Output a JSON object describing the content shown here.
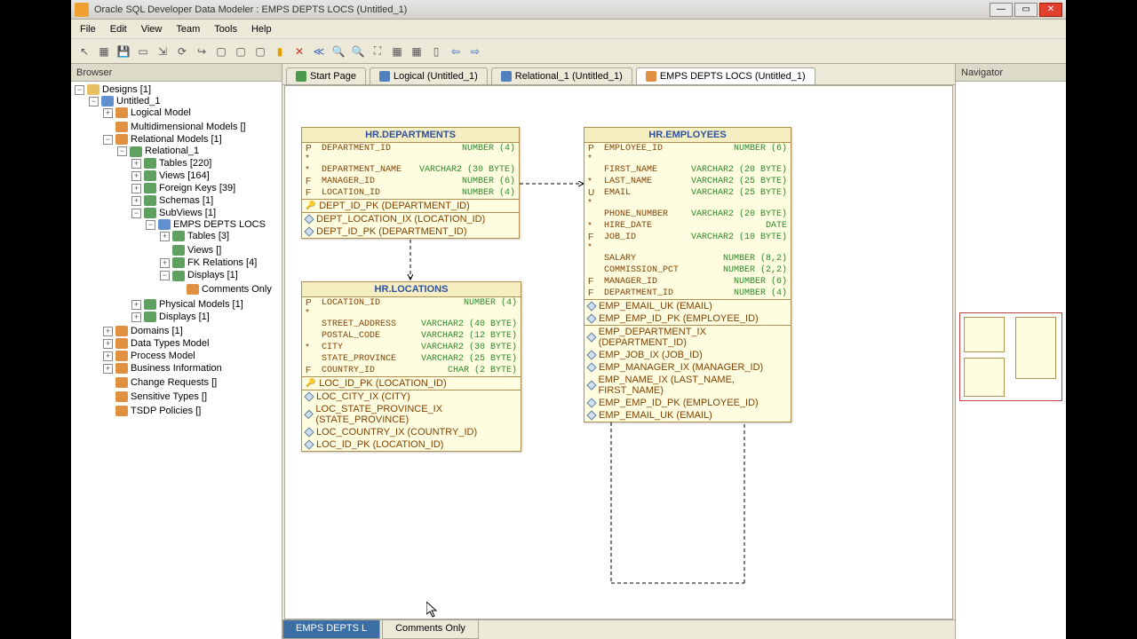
{
  "titlebar": {
    "app": "Oracle SQL Developer Data Modeler",
    "doc": "EMPS DEPTS LOCS (Untitled_1)"
  },
  "menu": [
    "File",
    "Edit",
    "View",
    "Team",
    "Tools",
    "Help"
  ],
  "panels": {
    "browser": "Browser",
    "navigator": "Navigator"
  },
  "tree": {
    "root": "Designs [1]",
    "untitled": "Untitled_1",
    "logical": "Logical Model",
    "multidim": "Multidimensional Models []",
    "relmodels": "Relational Models [1]",
    "rel1": "Relational_1",
    "tables": "Tables [220]",
    "views": "Views [164]",
    "fkeys": "Foreign Keys [39]",
    "schemas": "Schemas [1]",
    "subviews": "SubViews [1]",
    "emps": "EMPS DEPTS LOCS",
    "subtables": "Tables [3]",
    "subviews2": "Views []",
    "fkrel": "FK Relations [4]",
    "displays": "Displays [1]",
    "comments": "Comments Only",
    "physical": "Physical Models [1]",
    "displays2": "Displays [1]",
    "domains": "Domains [1]",
    "datatypes": "Data Types Model",
    "process": "Process Model",
    "business": "Business Information",
    "change": "Change Requests []",
    "sensitive": "Sensitive Types []",
    "tsdp": "TSDP Policies []"
  },
  "tabs": {
    "start": "Start Page",
    "logical": "Logical (Untitled_1)",
    "rel": "Relational_1 (Untitled_1)",
    "emps": "EMPS DEPTS LOCS (Untitled_1)"
  },
  "bottom_tabs": {
    "emps": "EMPS DEPTS L",
    "comments": "Comments Only"
  },
  "entities": {
    "departments": {
      "title": "HR.DEPARTMENTS",
      "cols": [
        {
          "mk": "P *",
          "name": "DEPARTMENT_ID",
          "type": "NUMBER (4)"
        },
        {
          "mk": "*",
          "name": "DEPARTMENT_NAME",
          "type": "VARCHAR2 (30 BYTE)"
        },
        {
          "mk": "F",
          "name": "MANAGER_ID",
          "type": "NUMBER (6)"
        },
        {
          "mk": "F",
          "name": "LOCATION_ID",
          "type": "NUMBER (4)"
        }
      ],
      "k1": "DEPT_ID_PK (DEPARTMENT_ID)",
      "idx": [
        "DEPT_LOCATION_IX (LOCATION_ID)",
        "DEPT_ID_PK (DEPARTMENT_ID)"
      ]
    },
    "employees": {
      "title": "HR.EMPLOYEES",
      "cols": [
        {
          "mk": "P *",
          "name": "EMPLOYEE_ID",
          "type": "NUMBER (6)"
        },
        {
          "mk": "",
          "name": "FIRST_NAME",
          "type": "VARCHAR2 (20 BYTE)"
        },
        {
          "mk": "*",
          "name": "LAST_NAME",
          "type": "VARCHAR2 (25 BYTE)"
        },
        {
          "mk": "U *",
          "name": "EMAIL",
          "type": "VARCHAR2 (25 BYTE)"
        },
        {
          "mk": "",
          "name": "PHONE_NUMBER",
          "type": "VARCHAR2 (20 BYTE)"
        },
        {
          "mk": "*",
          "name": "HIRE_DATE",
          "type": "DATE"
        },
        {
          "mk": "F *",
          "name": "JOB_ID",
          "type": "VARCHAR2 (10 BYTE)"
        },
        {
          "mk": "",
          "name": "SALARY",
          "type": "NUMBER (8,2)"
        },
        {
          "mk": "",
          "name": "COMMISSION_PCT",
          "type": "NUMBER (2,2)"
        },
        {
          "mk": "F",
          "name": "MANAGER_ID",
          "type": "NUMBER (6)"
        },
        {
          "mk": "F",
          "name": "DEPARTMENT_ID",
          "type": "NUMBER (4)"
        }
      ],
      "uk": [
        "EMP_EMAIL_UK (EMAIL)",
        "EMP_EMP_ID_PK (EMPLOYEE_ID)"
      ],
      "idx": [
        "EMP_DEPARTMENT_IX (DEPARTMENT_ID)",
        "EMP_JOB_IX (JOB_ID)",
        "EMP_MANAGER_IX (MANAGER_ID)",
        "EMP_NAME_IX (LAST_NAME, FIRST_NAME)",
        "EMP_EMP_ID_PK (EMPLOYEE_ID)",
        "EMP_EMAIL_UK (EMAIL)"
      ]
    },
    "locations": {
      "title": "HR.LOCATIONS",
      "cols": [
        {
          "mk": "P *",
          "name": "LOCATION_ID",
          "type": "NUMBER (4)"
        },
        {
          "mk": "",
          "name": "STREET_ADDRESS",
          "type": "VARCHAR2 (40 BYTE)"
        },
        {
          "mk": "",
          "name": "POSTAL_CODE",
          "type": "VARCHAR2 (12 BYTE)"
        },
        {
          "mk": "*",
          "name": "CITY",
          "type": "VARCHAR2 (30 BYTE)"
        },
        {
          "mk": "",
          "name": "STATE_PROVINCE",
          "type": "VARCHAR2 (25 BYTE)"
        },
        {
          "mk": "F",
          "name": "COUNTRY_ID",
          "type": "CHAR (2 BYTE)"
        }
      ],
      "k1": "LOC_ID_PK (LOCATION_ID)",
      "idx": [
        "LOC_CITY_IX (CITY)",
        "LOC_STATE_PROVINCE_IX (STATE_PROVINCE)",
        "LOC_COUNTRY_IX (COUNTRY_ID)",
        "LOC_ID_PK (LOCATION_ID)"
      ]
    }
  }
}
